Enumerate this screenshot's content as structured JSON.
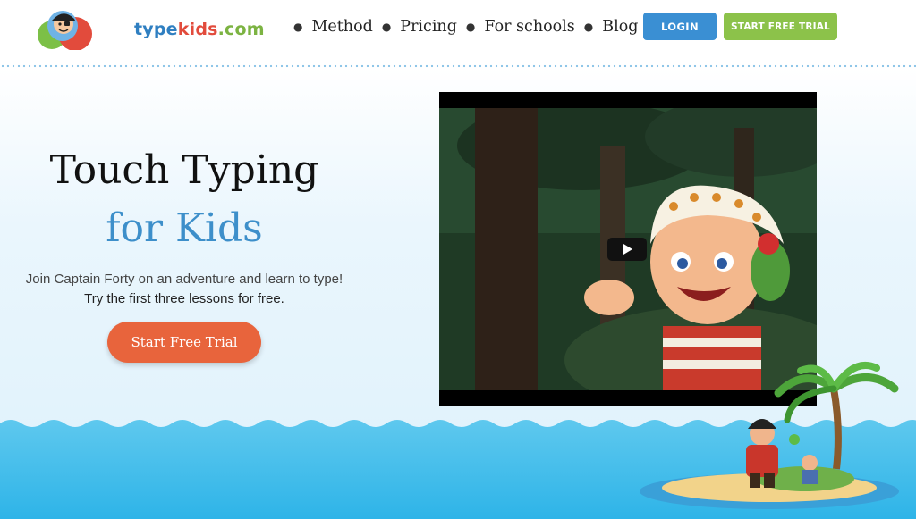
{
  "header": {
    "logo": {
      "part1": "type",
      "part2": "kids",
      "part3": ".com"
    },
    "nav": [
      {
        "label": "Method"
      },
      {
        "label": "Pricing"
      },
      {
        "label": "For schools"
      },
      {
        "label": "Blog"
      }
    ],
    "login_label": "LOGIN",
    "trial_label": "START FREE TRIAL"
  },
  "hero": {
    "title_line1": "Touch Typing",
    "title_line2": "for Kids",
    "subtitle_line1": "Join Captain Forty on an adventure and learn to type!",
    "subtitle_line2": "Try the first three lessons for free.",
    "cta_label": "Start Free Trial"
  },
  "colors": {
    "brand_blue": "#3a8fd3",
    "brand_green": "#8cc24a",
    "cta_orange": "#e8643c",
    "title_blue": "#3d8fca"
  },
  "icons": {
    "video": "play-icon",
    "logo": "pirate-kid-logo-icon"
  }
}
